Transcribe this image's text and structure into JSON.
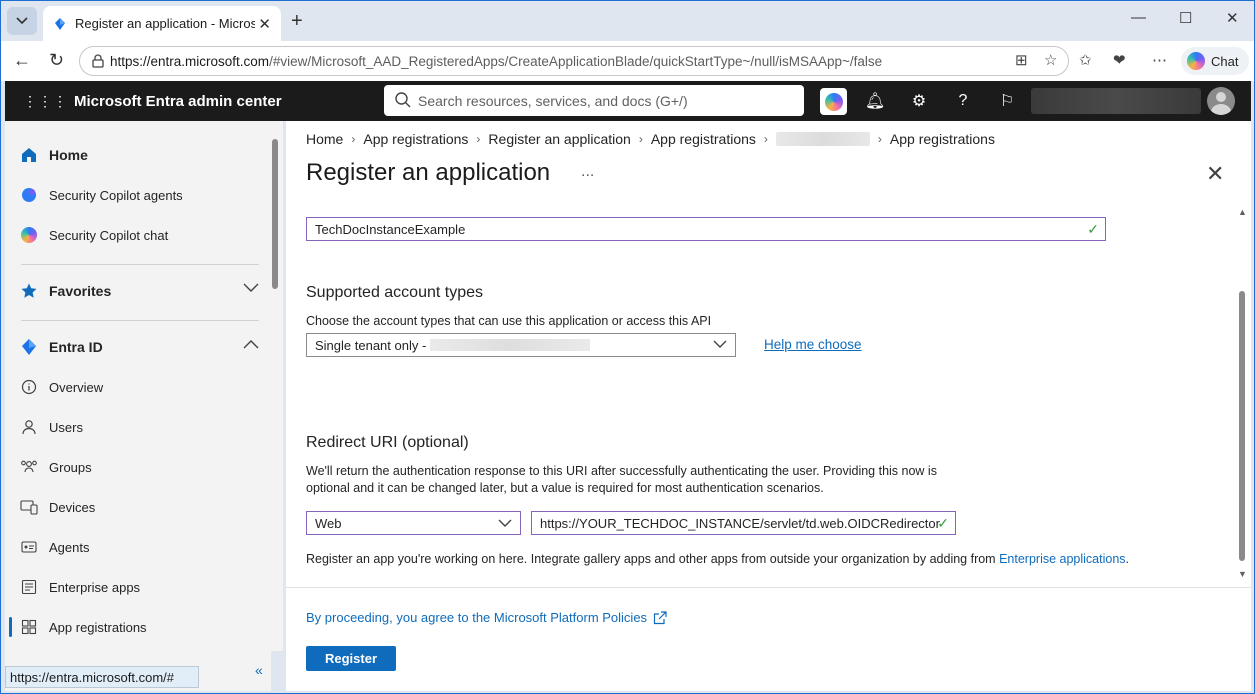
{
  "browser": {
    "tab_title": "Register an application - Microsoft",
    "url_host": "https://entra.microsoft.com",
    "url_path": "/#view/Microsoft_AAD_RegisteredApps/CreateApplicationBlade/quickStartType~/null/isMSAApp~/false",
    "chat_label": "Chat",
    "status_url": "https://entra.microsoft.com/#"
  },
  "portal": {
    "brand": "Microsoft Entra admin center",
    "search_placeholder": "Search resources, services, and docs (G+/)"
  },
  "sidebar": {
    "home": "Home",
    "copilot_agents": "Security Copilot agents",
    "copilot_chat": "Security Copilot chat",
    "favorites": "Favorites",
    "entra_id": "Entra ID",
    "items": [
      "Overview",
      "Users",
      "Groups",
      "Devices",
      "Agents",
      "Enterprise apps",
      "App registrations"
    ],
    "active_item": "App registrations"
  },
  "breadcrumb": [
    "Home",
    "App registrations",
    "Register an application",
    "App registrations",
    "App registrations"
  ],
  "main": {
    "title": "Register an application",
    "more": "...",
    "app_name_value": "TechDocInstanceExample",
    "account_types_heading": "Supported account types",
    "account_types_label": "Choose the account types that can use this application or access this API",
    "account_type_value": "Single tenant only - ",
    "help_link": "Help me choose",
    "redirect_heading": "Redirect URI (optional)",
    "redirect_desc_1": "We'll return the authentication response to this URI after successfully authenticating the user. Providing this now is",
    "redirect_desc_2": "optional and it can be changed later, but a value is required for most authentication scenarios.",
    "platform_value": "Web",
    "redirect_uri_value": "https://YOUR_TECHDOC_INSTANCE/servlet/td.web.OIDCRedirector",
    "gallery_text": "Register an app you're working on here. Integrate gallery apps and other apps from outside your organization by adding from ",
    "gallery_link": "Enterprise applications",
    "gallery_end": ".",
    "policy_text": "By proceeding, you agree to the Microsoft Platform Policies",
    "register_label": "Register"
  },
  "colors": {
    "accent": "#0f6cbd",
    "field_focus": "#8764b8",
    "valid": "#3a9b3a",
    "header_bg": "#1b1b1b"
  }
}
